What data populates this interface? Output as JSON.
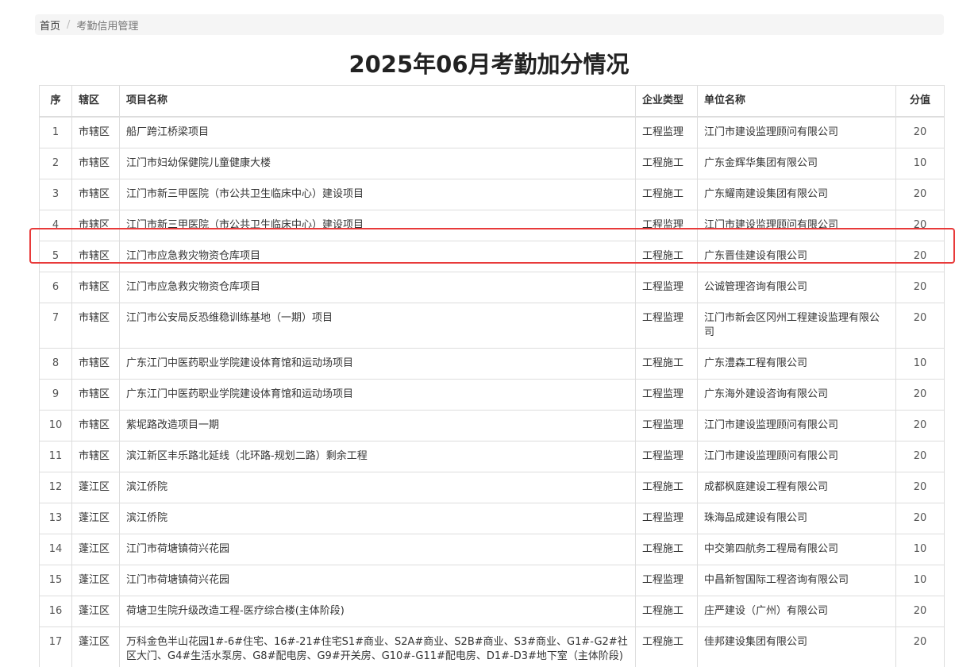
{
  "breadcrumb": {
    "home": "首页",
    "separator": "/",
    "current": "考勤信用管理"
  },
  "page_title": "2025年06月考勤加分情况",
  "table": {
    "headers": {
      "index": "序",
      "district": "辖区",
      "project": "项目名称",
      "type": "企业类型",
      "company": "单位名称",
      "score": "分值"
    },
    "rows": [
      {
        "index": "1",
        "district": "市辖区",
        "project": "船厂跨江桥梁项目",
        "type": "工程监理",
        "company": "江门市建设监理顾问有限公司",
        "score": "20"
      },
      {
        "index": "2",
        "district": "市辖区",
        "project": "江门市妇幼保健院儿童健康大楼",
        "type": "工程施工",
        "company": "广东金辉华集团有限公司",
        "score": "10"
      },
      {
        "index": "3",
        "district": "市辖区",
        "project": "江门市新三甲医院（市公共卫生临床中心）建设项目",
        "type": "工程施工",
        "company": "广东耀南建设集团有限公司",
        "score": "20"
      },
      {
        "index": "4",
        "district": "市辖区",
        "project": "江门市新三甲医院（市公共卫生临床中心）建设项目",
        "type": "工程监理",
        "company": "江门市建设监理顾问有限公司",
        "score": "20"
      },
      {
        "index": "5",
        "district": "市辖区",
        "project": "江门市应急救灾物资仓库项目",
        "type": "工程施工",
        "company": "广东晋佳建设有限公司",
        "score": "20"
      },
      {
        "index": "6",
        "district": "市辖区",
        "project": "江门市应急救灾物资仓库项目",
        "type": "工程监理",
        "company": "公诚管理咨询有限公司",
        "score": "20"
      },
      {
        "index": "7",
        "district": "市辖区",
        "project": "江门市公安局反恐维稳训练基地（一期）项目",
        "type": "工程监理",
        "company": "江门市新会区冈州工程建设监理有限公司",
        "score": "20"
      },
      {
        "index": "8",
        "district": "市辖区",
        "project": "广东江门中医药职业学院建设体育馆和运动场项目",
        "type": "工程施工",
        "company": "广东澧森工程有限公司",
        "score": "10"
      },
      {
        "index": "9",
        "district": "市辖区",
        "project": "广东江门中医药职业学院建设体育馆和运动场项目",
        "type": "工程监理",
        "company": "广东海外建设咨询有限公司",
        "score": "20"
      },
      {
        "index": "10",
        "district": "市辖区",
        "project": "紫坭路改造项目一期",
        "type": "工程监理",
        "company": "江门市建设监理顾问有限公司",
        "score": "20"
      },
      {
        "index": "11",
        "district": "市辖区",
        "project": "滨江新区丰乐路北延线（北环路-规划二路）剩余工程",
        "type": "工程监理",
        "company": "江门市建设监理顾问有限公司",
        "score": "20"
      },
      {
        "index": "12",
        "district": "蓬江区",
        "project": "滨江侨院",
        "type": "工程施工",
        "company": "成都枫庭建设工程有限公司",
        "score": "20"
      },
      {
        "index": "13",
        "district": "蓬江区",
        "project": "滨江侨院",
        "type": "工程监理",
        "company": "珠海品成建设有限公司",
        "score": "20"
      },
      {
        "index": "14",
        "district": "蓬江区",
        "project": "江门市荷塘镇荷兴花园",
        "type": "工程施工",
        "company": "中交第四航务工程局有限公司",
        "score": "10"
      },
      {
        "index": "15",
        "district": "蓬江区",
        "project": "江门市荷塘镇荷兴花园",
        "type": "工程监理",
        "company": "中昌新智国际工程咨询有限公司",
        "score": "10"
      },
      {
        "index": "16",
        "district": "蓬江区",
        "project": "荷塘卫生院升级改造工程-医疗综合楼(主体阶段)",
        "type": "工程施工",
        "company": "庄严建设（广州）有限公司",
        "score": "20"
      },
      {
        "index": "17",
        "district": "蓬江区",
        "project": "万科金色半山花园1#-6#住宅、16#-21#住宅S1#商业、S2A#商业、S2B#商业、S3#商业、G1#-G2#社区大门、G4#生活水泵房、G8#配电房、G9#开关房、G10#-G11#配电房、D1#-D3#地下室（主体阶段)",
        "type": "工程施工",
        "company": "佳邦建设集团有限公司",
        "score": "20"
      }
    ]
  },
  "highlight": {
    "row_index": "5",
    "color": "#e83a3a"
  },
  "colors": {
    "border": "#dddddd",
    "breadcrumb_bg": "#f5f5f5",
    "text": "#333333"
  }
}
